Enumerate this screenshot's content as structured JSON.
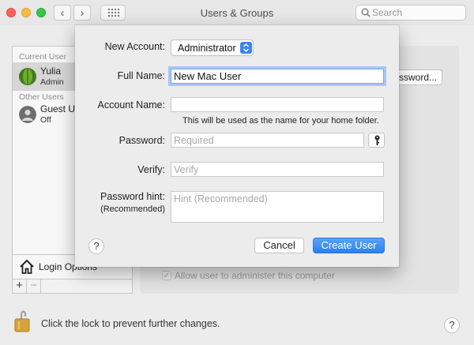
{
  "window": {
    "title": "Users & Groups",
    "search_placeholder": "Search"
  },
  "nav": {
    "back_glyph": "‹",
    "forward_glyph": "›"
  },
  "user_list": {
    "current_user_header": "Current User",
    "current_user": {
      "name": "Yulia",
      "role": "Admin"
    },
    "other_users_header": "Other Users",
    "other_users": [
      {
        "name": "Guest U",
        "role": "Off"
      }
    ],
    "login_options_label": "Login Options",
    "add_symbol": "+",
    "remove_symbol": "−"
  },
  "background_panel": {
    "change_password_fragment": "ssword...",
    "admin_checkbox_label": "Allow user to administer this computer",
    "admin_checked": true
  },
  "lock": {
    "label": "Click the lock to prevent further changes.",
    "icon": "lock-icon"
  },
  "dialog": {
    "new_account_label": "New Account:",
    "new_account_value": "Administrator",
    "full_name_label": "Full Name:",
    "full_name_value": "New Mac User",
    "account_name_label": "Account Name:",
    "account_name_value": "",
    "account_name_hint": "This will be used as the name for your home folder.",
    "password_label": "Password:",
    "password_placeholder": "Required",
    "verify_label": "Verify:",
    "verify_placeholder": "Verify",
    "hint_label": "Password hint:",
    "hint_sublabel": "(Recommended)",
    "hint_placeholder": "Hint (Recommended)",
    "help_glyph": "?",
    "cancel_label": "Cancel",
    "create_label": "Create User"
  },
  "colors": {
    "accent": "#2b7ff0",
    "focus_ring": "#a7c6f4"
  }
}
